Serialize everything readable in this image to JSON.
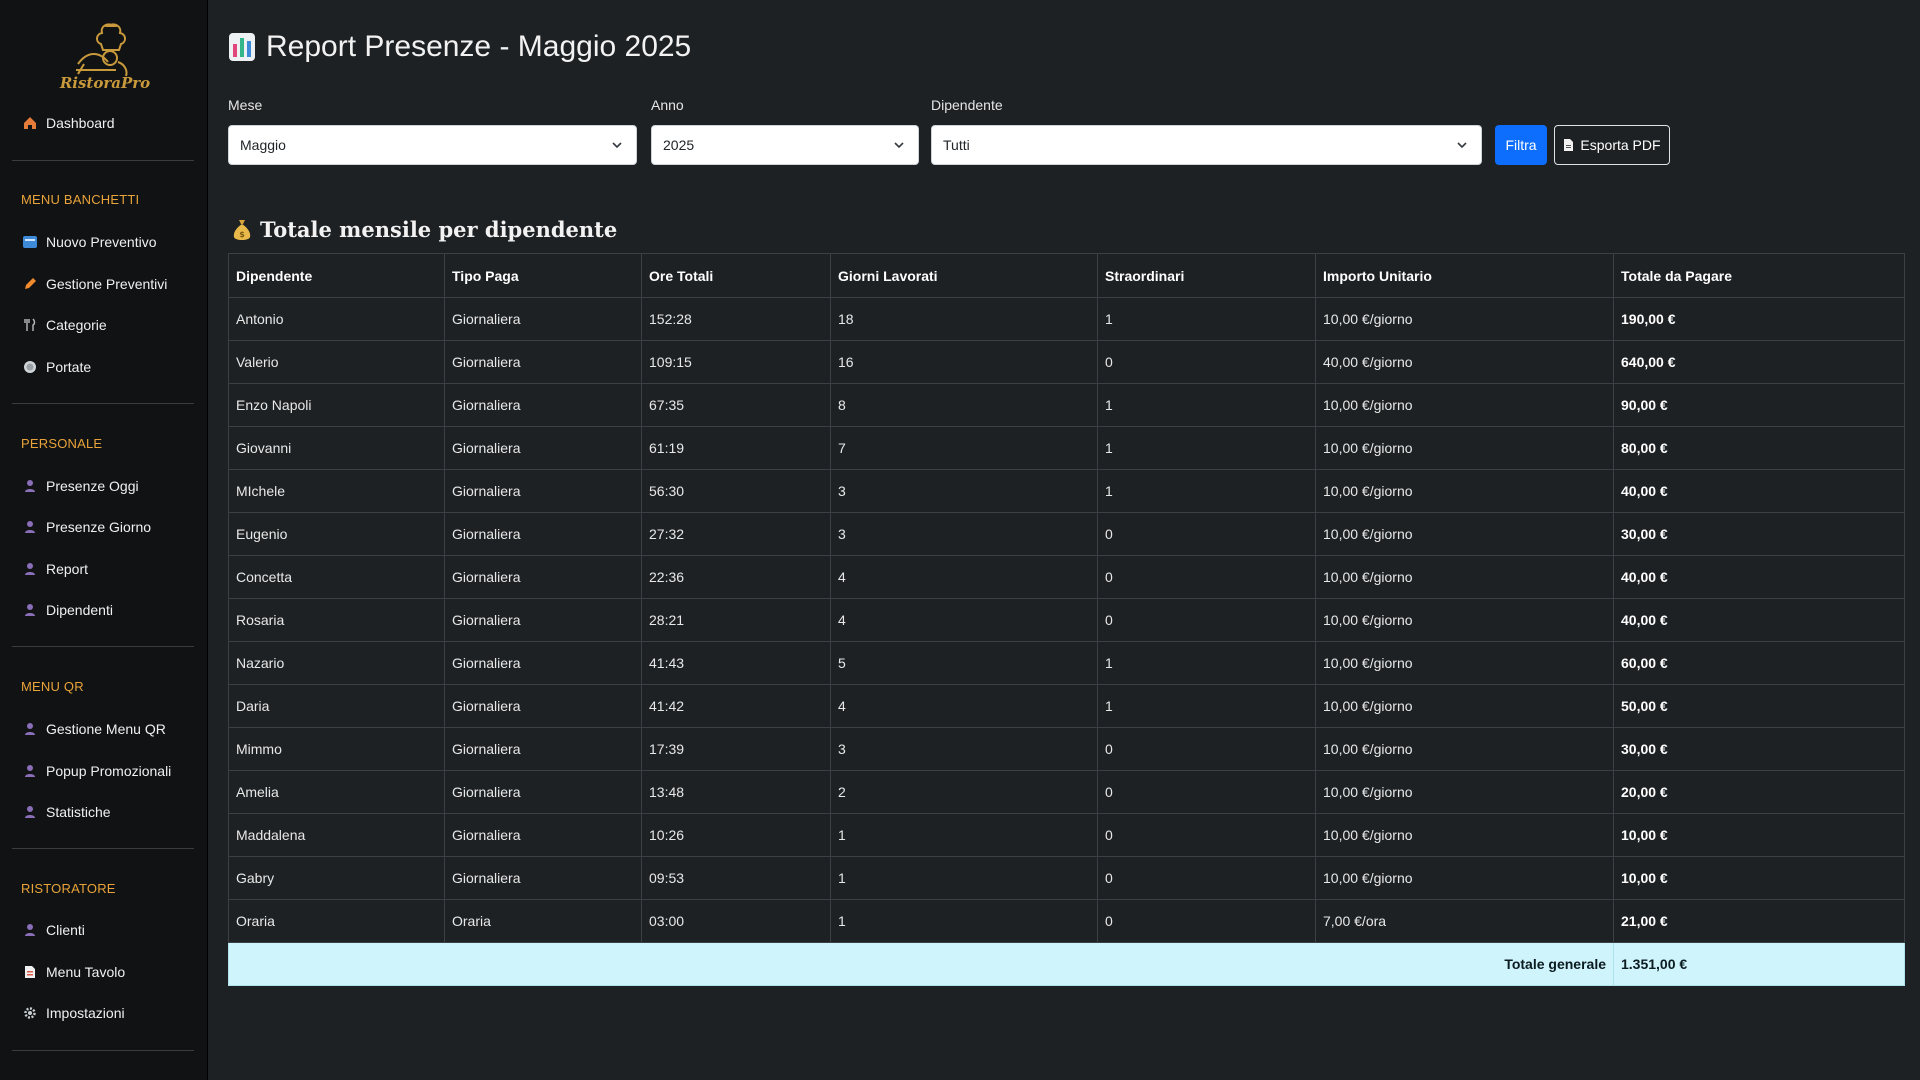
{
  "sidebar": {
    "logo_text": "RistoraPro",
    "dashboard": "Dashboard",
    "sections": [
      {
        "title": "MENU BANCHETTI",
        "items": [
          "Nuovo Preventivo",
          "Gestione Preventivi",
          "Categorie",
          "Portate"
        ]
      },
      {
        "title": "PERSONALE",
        "items": [
          "Presenze Oggi",
          "Presenze Giorno",
          "Report",
          "Dipendenti"
        ]
      },
      {
        "title": "MENU QR",
        "items": [
          "Gestione Menu QR",
          "Popup Promozionali",
          "Statistiche"
        ]
      },
      {
        "title": "RISTORATORE",
        "items": [
          "Clienti",
          "Menu Tavolo",
          "Impostazioni"
        ]
      }
    ]
  },
  "header": {
    "title": "Report Presenze - Maggio 2025"
  },
  "filters": {
    "month_label": "Mese",
    "month_value": "Maggio",
    "year_label": "Anno",
    "year_value": "2025",
    "employee_label": "Dipendente",
    "employee_value": "Tutti",
    "filter_button": "Filtra",
    "export_button": "Esporta PDF"
  },
  "report": {
    "title": "Totale mensile per dipendente",
    "columns": [
      "Dipendente",
      "Tipo Paga",
      "Ore Totali",
      "Giorni Lavorati",
      "Straordinari",
      "Importo Unitario",
      "Totale da Pagare"
    ],
    "rows": [
      [
        "Antonio",
        "Giornaliera",
        "152:28",
        "18",
        "1",
        "10,00 €/giorno",
        "190,00 €"
      ],
      [
        "Valerio",
        "Giornaliera",
        "109:15",
        "16",
        "0",
        "40,00 €/giorno",
        "640,00 €"
      ],
      [
        "Enzo Napoli",
        "Giornaliera",
        "67:35",
        "8",
        "1",
        "10,00 €/giorno",
        "90,00 €"
      ],
      [
        "Giovanni",
        "Giornaliera",
        "61:19",
        "7",
        "1",
        "10,00 €/giorno",
        "80,00 €"
      ],
      [
        "MIchele",
        "Giornaliera",
        "56:30",
        "3",
        "1",
        "10,00 €/giorno",
        "40,00 €"
      ],
      [
        "Eugenio",
        "Giornaliera",
        "27:32",
        "3",
        "0",
        "10,00 €/giorno",
        "30,00 €"
      ],
      [
        "Concetta",
        "Giornaliera",
        "22:36",
        "4",
        "0",
        "10,00 €/giorno",
        "40,00 €"
      ],
      [
        "Rosaria",
        "Giornaliera",
        "28:21",
        "4",
        "0",
        "10,00 €/giorno",
        "40,00 €"
      ],
      [
        "Nazario",
        "Giornaliera",
        "41:43",
        "5",
        "1",
        "10,00 €/giorno",
        "60,00 €"
      ],
      [
        "Daria",
        "Giornaliera",
        "41:42",
        "4",
        "1",
        "10,00 €/giorno",
        "50,00 €"
      ],
      [
        "Mimmo",
        "Giornaliera",
        "17:39",
        "3",
        "0",
        "10,00 €/giorno",
        "30,00 €"
      ],
      [
        "Amelia",
        "Giornaliera",
        "13:48",
        "2",
        "0",
        "10,00 €/giorno",
        "20,00 €"
      ],
      [
        "Maddalena",
        "Giornaliera",
        "10:26",
        "1",
        "0",
        "10,00 €/giorno",
        "10,00 €"
      ],
      [
        "Gabry",
        "Giornaliera",
        "09:53",
        "1",
        "0",
        "10,00 €/giorno",
        "10,00 €"
      ],
      [
        "Oraria",
        "Oraria",
        "03:00",
        "1",
        "0",
        "7,00 €/ora",
        "21,00 €"
      ]
    ],
    "footer_label": "Totale generale",
    "footer_total": "1.351,00 €"
  },
  "colors": {
    "accent": "#0d6efd",
    "section": "#e8a33a",
    "footer_bg": "#cff4fc"
  }
}
